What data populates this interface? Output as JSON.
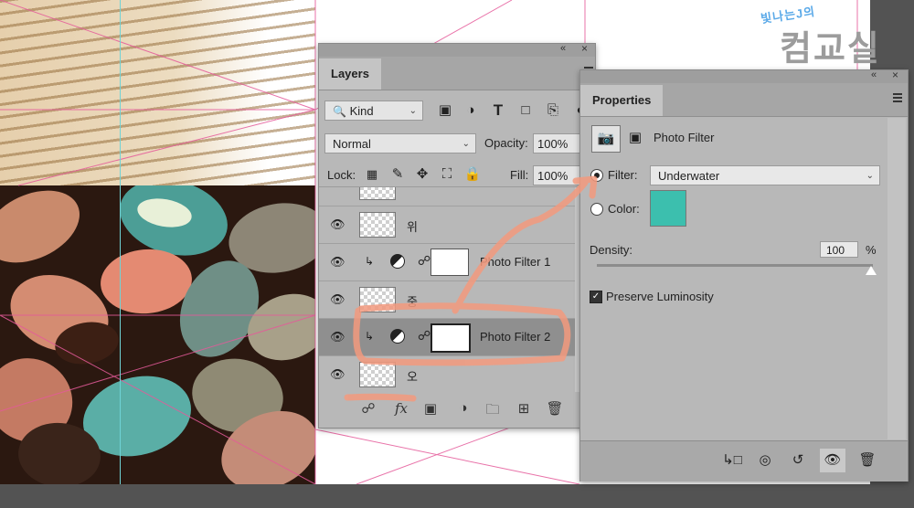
{
  "watermark": {
    "small": "빛나는J의",
    "big": "컴교실"
  },
  "colors": {
    "panel_bg": "#b8b8b8",
    "selected_row": "#8f8f8f",
    "filter_color": "#3cbfae",
    "annotation": "#f39a7e",
    "guide_pink": "#e55a9a",
    "guide_cyan": "#6fd3d6"
  },
  "layers_panel": {
    "tab": "Layers",
    "collapse_icon": "«",
    "close_icon": "×",
    "kind_label": "Kind",
    "blend_mode": "Normal",
    "opacity_label": "Opacity:",
    "opacity_value": "100%",
    "lock_label": "Lock:",
    "fill_label": "Fill:",
    "fill_value": "100%",
    "layers": [
      {
        "name": "위",
        "type": "pixel",
        "visible": true,
        "selected": false
      },
      {
        "name": "Photo Filter 1",
        "type": "adjustment",
        "visible": true,
        "selected": false
      },
      {
        "name": "중",
        "type": "pixel",
        "visible": true,
        "selected": false
      },
      {
        "name": "Photo Filter 2",
        "type": "adjustment",
        "visible": true,
        "selected": true
      },
      {
        "name": "오",
        "type": "pixel",
        "visible": true,
        "selected": false
      }
    ]
  },
  "properties_panel": {
    "tab": "Properties",
    "collapse_icon": "«",
    "close_icon": "×",
    "title": "Photo Filter",
    "filter_label": "Filter:",
    "filter_value": "Underwater",
    "color_label": "Color:",
    "density_label": "Density:",
    "density_value": "100",
    "density_unit": "%",
    "density_level": 1.0,
    "preserve_label": "Preserve Luminosity",
    "preserve_checked": true
  }
}
